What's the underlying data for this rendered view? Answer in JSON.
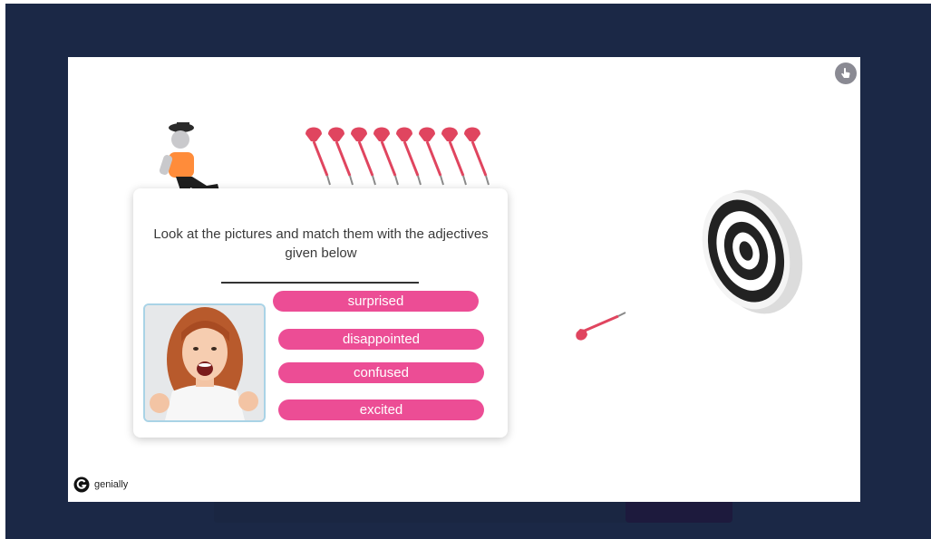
{
  "slide": {
    "question": "Look at the pictures and match them with the adjectives given below",
    "options": [
      {
        "label": "surprised"
      },
      {
        "label": "disappointed"
      },
      {
        "label": "confused"
      },
      {
        "label": "excited"
      }
    ]
  },
  "brand": {
    "name": "genially"
  },
  "icons": {
    "corner": "hand-pointer-icon",
    "brand": "genially-logo-icon"
  },
  "colors": {
    "background": "#1b2846",
    "option": "#ec4d95",
    "dart": "#e0455f"
  }
}
